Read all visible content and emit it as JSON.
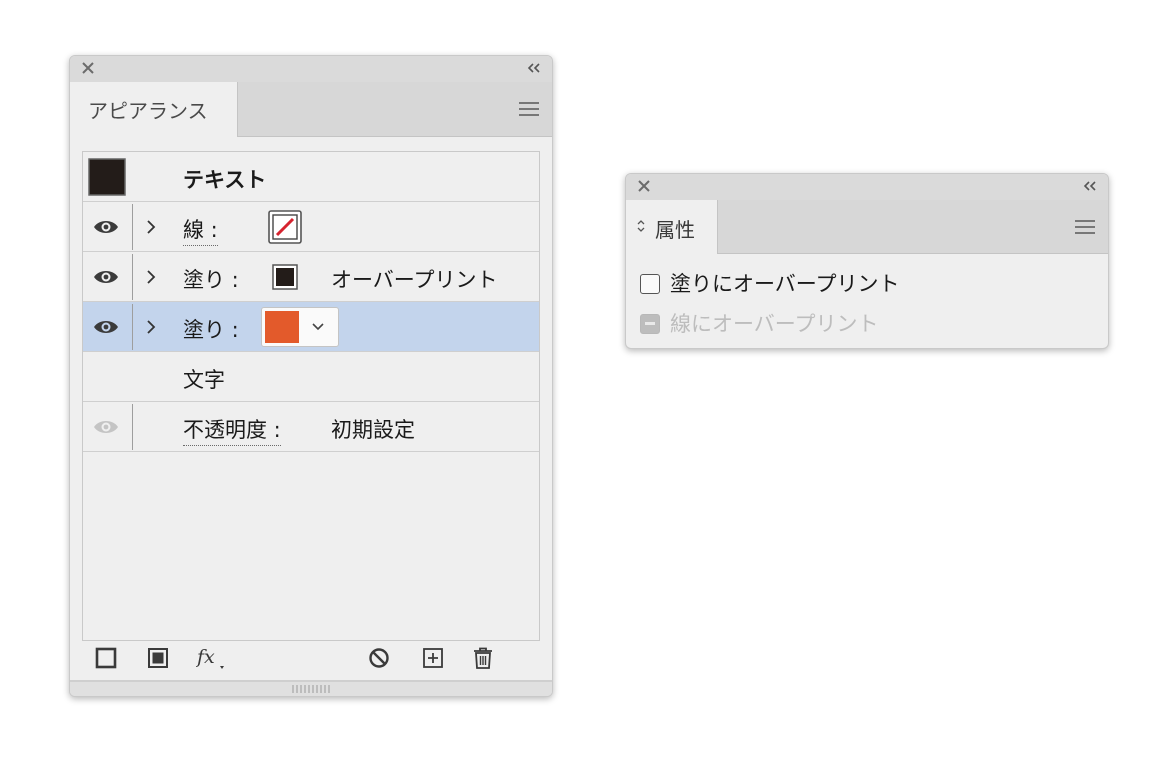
{
  "appearance_panel": {
    "tab_title": "アピアランス",
    "header_label": "テキスト",
    "rows": [
      {
        "label": "線 :",
        "value": ""
      },
      {
        "label": "塗り :",
        "value": "オーバープリント"
      },
      {
        "label": "塗り :",
        "value": ""
      },
      {
        "label": "文字",
        "value": ""
      },
      {
        "label": "不透明度 :",
        "value": "初期設定"
      }
    ],
    "colors": {
      "header_swatch": "#231c19",
      "fill1": "#231c19",
      "fill2": "#e35a2b",
      "stroke_none": "#d6232f",
      "selected_row": "#c3d4ec"
    },
    "icons": [
      "close-icon",
      "collapse-icon",
      "panel-menu-icon",
      "eye-icon",
      "chevron-right-icon",
      "chevron-down-icon",
      "add-new-stroke-icon",
      "add-new-fill-icon",
      "fx-icon",
      "clear-appearance-icon",
      "duplicate-item-icon",
      "delete-icon"
    ]
  },
  "attributes_panel": {
    "tab_title": "属性",
    "overprint_fill": "塗りにオーバープリント",
    "overprint_stroke": "線にオーバープリント",
    "overprint_fill_checked": false,
    "overprint_stroke_enabled": false
  }
}
